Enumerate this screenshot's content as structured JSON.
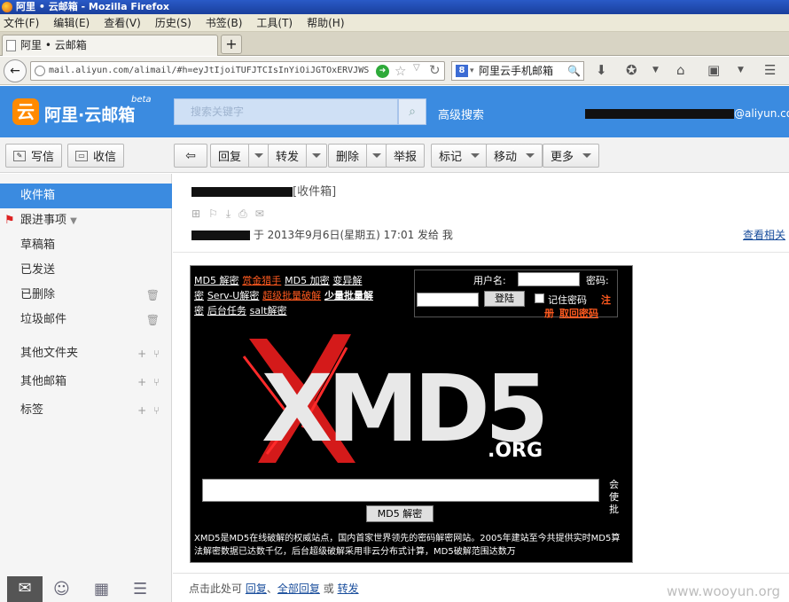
{
  "window": {
    "title": "阿里 • 云邮箱 - Mozilla Firefox"
  },
  "menu": [
    "文件(F)",
    "编辑(E)",
    "查看(V)",
    "历史(S)",
    "书签(B)",
    "工具(T)",
    "帮助(H)"
  ],
  "tab": {
    "title": "阿里 • 云邮箱",
    "newtab": "+"
  },
  "nav": {
    "url": "mail.aliyun.com/alimail/#h=eyJtIjoiTUFJTCIsInYiOiJGTOxERVJWS",
    "search_engine_text": "阿里云手机邮箱"
  },
  "header": {
    "logo_char": "云",
    "logo_text": "阿里·云邮箱",
    "beta": "beta",
    "search_placeholder": "搜索关键字",
    "advanced_search": "高级搜索",
    "user_suffix": "@aliyun.com"
  },
  "toolbar": {
    "compose": "写信",
    "receive": "收信",
    "back": "⇦",
    "reply": "回复",
    "forward": "转发",
    "delete": "删除",
    "report": "举报",
    "mark": "标记",
    "move": "移动",
    "more": "更多"
  },
  "sidebar": {
    "items": [
      {
        "label": "收件箱"
      },
      {
        "label": "跟进事项"
      },
      {
        "label": "草稿箱"
      },
      {
        "label": "已发送"
      },
      {
        "label": "已删除"
      },
      {
        "label": "垃圾邮件"
      },
      {
        "label": "其他文件夹"
      },
      {
        "label": "其他邮箱"
      },
      {
        "label": "标签"
      }
    ]
  },
  "message": {
    "folder_tag": "[收件箱]",
    "meta_text": "于 2013年9月6日(星期五) 17:01 发给 我",
    "view_related": "查看相关",
    "frame": {
      "links_line1": [
        "MD5 解密",
        "赏金猎手",
        "MD5 加密",
        "变异解"
      ],
      "links_line2": [
        "密",
        "Serv-U解密",
        "超级批量破解",
        "少量批量解"
      ],
      "links_line3": [
        "密",
        "后台任务",
        "salt解密"
      ],
      "username_label": "用户名:",
      "password_label": "密码:",
      "login_button": "登陆",
      "remember": "记住密码",
      "register": "注",
      "register2": "册",
      "recover": "取回密码",
      "logo_main": "XMD5",
      "logo_org": ".ORG",
      "decrypt_button": "MD5 解密",
      "side_text": "会使批",
      "description": "XMD5是MD5在线破解的权威站点，国内首家世界领先的密码解密网站。2005年建站至今共提供实时MD5算法解密数据已达数千亿，后台超级破解采用非云分布式计算，MD5破解范围达数万"
    }
  },
  "reply_bar": {
    "prefix": "点击此处可",
    "reply": "回复",
    "sep1": "、",
    "reply_all": "全部回复",
    "or": "或",
    "forward": "转发"
  },
  "watermark": "www.wooyun.org"
}
